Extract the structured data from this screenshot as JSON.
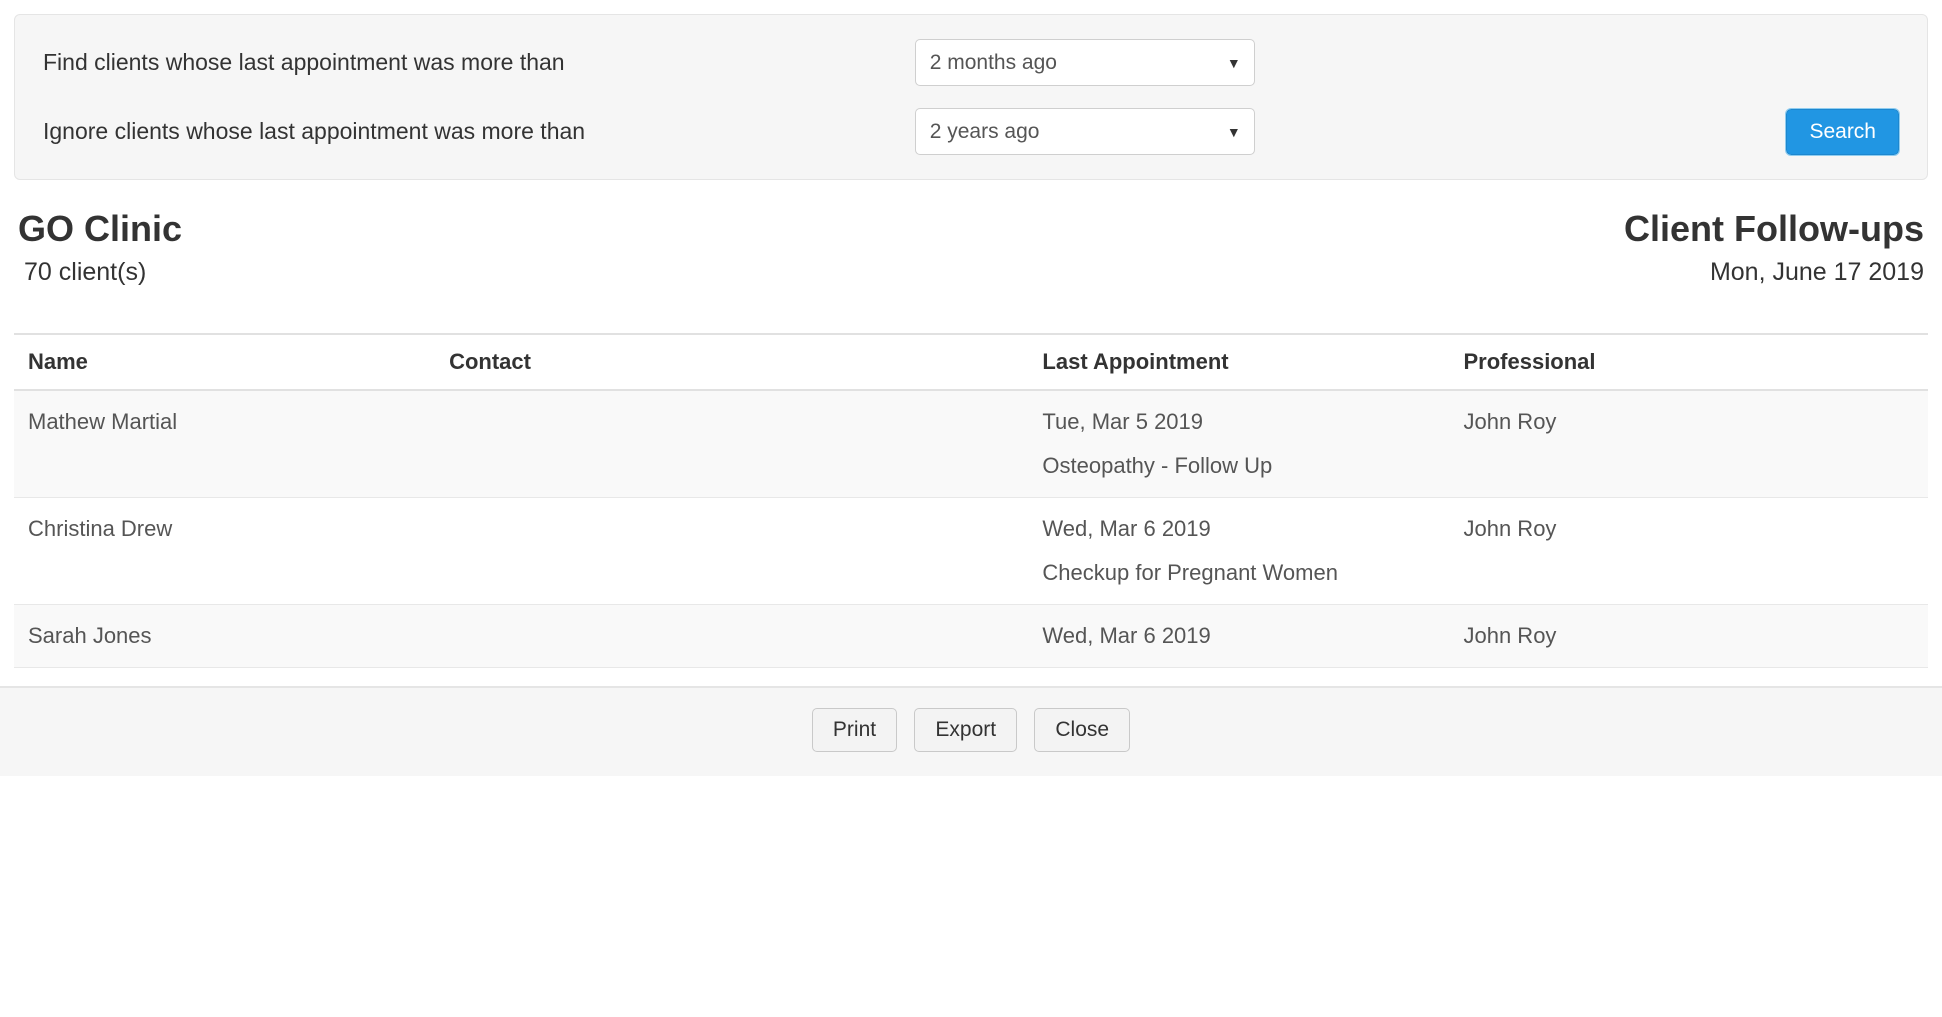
{
  "filters": {
    "find_label": "Find clients whose last appointment was more than",
    "find_value": "2 months ago",
    "ignore_label": "Ignore clients whose last appointment was more than",
    "ignore_value": "2 years ago",
    "search_button": "Search"
  },
  "header": {
    "clinic_name": "GO Clinic",
    "client_count_number": "70",
    "client_count_label": " client(s)",
    "report_title": "Client Follow-ups",
    "report_date": "Mon, June 17 2019"
  },
  "table": {
    "columns": {
      "name": "Name",
      "contact": "Contact",
      "last_appointment": "Last Appointment",
      "professional": "Professional"
    },
    "rows": [
      {
        "name": "Mathew Martial",
        "contact": "",
        "last_appointment_date": "Tue, Mar 5 2019",
        "last_appointment_type": "Osteopathy - Follow Up",
        "professional": "John Roy"
      },
      {
        "name": "Christina Drew",
        "contact": "",
        "last_appointment_date": "Wed, Mar 6 2019",
        "last_appointment_type": "Checkup for Pregnant Women",
        "professional": "John Roy"
      },
      {
        "name": "Sarah Jones",
        "contact": "",
        "last_appointment_date": "Wed, Mar 6 2019",
        "last_appointment_type": "",
        "professional": "John Roy"
      }
    ]
  },
  "footer": {
    "print": "Print",
    "export": "Export",
    "close": "Close"
  }
}
